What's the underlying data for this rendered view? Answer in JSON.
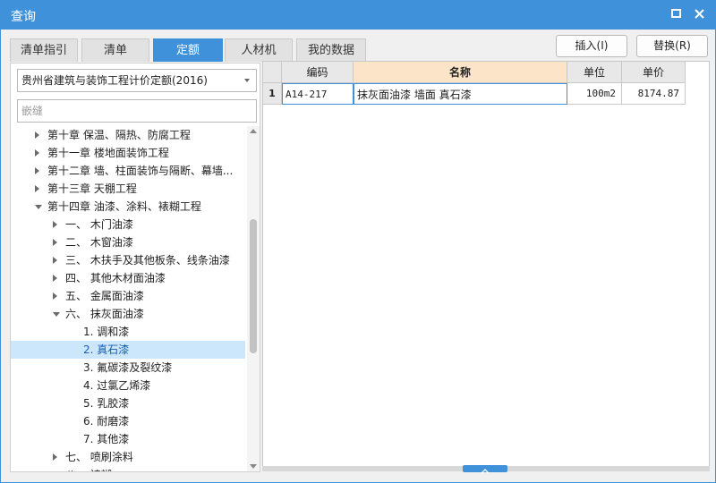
{
  "window": {
    "title": "查询"
  },
  "tabs": [
    {
      "label": "清单指引"
    },
    {
      "label": "清单"
    },
    {
      "label": "定额"
    },
    {
      "label": "人材机"
    },
    {
      "label": "我的数据"
    }
  ],
  "toolbar": {
    "insert_label": "插入(I)",
    "replace_label": "替换(R)"
  },
  "left": {
    "quota_library": "贵州省建筑与装饰工程计价定额(2016)",
    "search_placeholder": "嵌缝",
    "tree": [
      {
        "label": "第十章 保温、隔热、防腐工程",
        "level": 0,
        "state": "collapsed"
      },
      {
        "label": "第十一章 楼地面装饰工程",
        "level": 0,
        "state": "collapsed"
      },
      {
        "label": "第十二章 墙、柱面装饰与隔断、幕墙...",
        "level": 0,
        "state": "collapsed"
      },
      {
        "label": "第十三章 天棚工程",
        "level": 0,
        "state": "collapsed"
      },
      {
        "label": "第十四章 油漆、涂料、裱糊工程",
        "level": 0,
        "state": "expanded"
      },
      {
        "label": "一、  木门油漆",
        "level": 1,
        "state": "collapsed"
      },
      {
        "label": "二、  木窗油漆",
        "level": 1,
        "state": "collapsed"
      },
      {
        "label": "三、  木扶手及其他板条、线条油漆",
        "level": 1,
        "state": "collapsed"
      },
      {
        "label": "四、  其他木材面油漆",
        "level": 1,
        "state": "collapsed"
      },
      {
        "label": "五、  金属面油漆",
        "level": 1,
        "state": "collapsed"
      },
      {
        "label": "六、  抹灰面油漆",
        "level": 1,
        "state": "expanded"
      },
      {
        "label": "1. 调和漆",
        "level": 2,
        "state": "leaf"
      },
      {
        "label": "2. 真石漆",
        "level": 2,
        "state": "leaf",
        "selected": true
      },
      {
        "label": "3. 氟碳漆及裂纹漆",
        "level": 2,
        "state": "leaf"
      },
      {
        "label": "4. 过氯乙烯漆",
        "level": 2,
        "state": "leaf"
      },
      {
        "label": "5. 乳胶漆",
        "level": 2,
        "state": "leaf"
      },
      {
        "label": "6. 耐磨漆",
        "level": 2,
        "state": "leaf"
      },
      {
        "label": "7. 其他漆",
        "level": 2,
        "state": "leaf"
      },
      {
        "label": "七、  喷刷涂料",
        "level": 1,
        "state": "collapsed"
      },
      {
        "label": "八、  裱糊",
        "level": 1,
        "state": "collapsed"
      }
    ]
  },
  "table": {
    "columns": [
      "编码",
      "名称",
      "单位",
      "单价"
    ],
    "rows": [
      {
        "num": "1",
        "code": "A14-217",
        "name": "抹灰面油漆 墙面 真石漆",
        "unit": "100m2",
        "price": "8174.87"
      }
    ]
  },
  "colors": {
    "accent": "#3f92da",
    "selected_row": "#cce6fb",
    "header_highlight": "#fce4c8"
  }
}
